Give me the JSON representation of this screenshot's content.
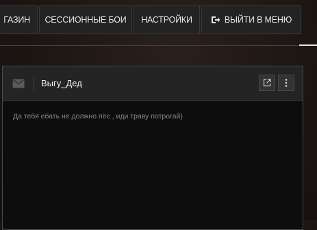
{
  "nav": {
    "shop_label": "ГАЗИН",
    "session_label": "СЕССИОННЫЕ БОИ",
    "settings_label": "НАСТРОЙКИ",
    "exit_label": "ВЫЙТИ В МЕНЮ",
    "exit_icon": "exit-icon"
  },
  "message": {
    "icon": "mail-icon",
    "sender": "Выгу_Дед",
    "body": "Да тебя ебать не должно пёс , иди траву потрогай)",
    "actions": [
      "external-link-icon",
      "more-vertical-icon"
    ]
  }
}
